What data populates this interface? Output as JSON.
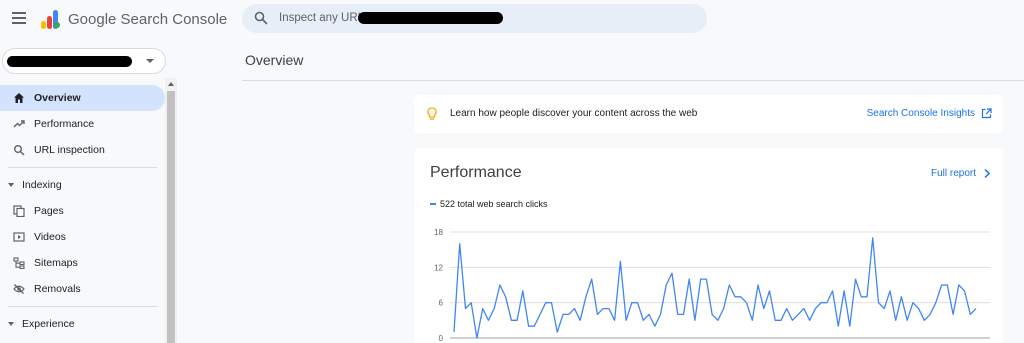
{
  "app": {
    "title": "Google Search Console",
    "brand_colors": [
      "#fbbc04",
      "#ea4335",
      "#4285f4",
      "#34a853"
    ]
  },
  "search": {
    "placeholder": "Inspect any URL i"
  },
  "property": {
    "value_redacted": true
  },
  "nav": {
    "items": [
      {
        "label": "Overview",
        "icon": "home-icon",
        "active": true
      },
      {
        "label": "Performance",
        "icon": "trending-up-icon"
      },
      {
        "label": "URL inspection",
        "icon": "search-icon"
      }
    ],
    "indexing": {
      "label": "Indexing",
      "items": [
        {
          "label": "Pages",
          "icon": "pages-icon"
        },
        {
          "label": "Videos",
          "icon": "video-icon"
        },
        {
          "label": "Sitemaps",
          "icon": "sitemap-icon"
        },
        {
          "label": "Removals",
          "icon": "visibility-off-icon"
        }
      ]
    },
    "experience": {
      "label": "Experience"
    }
  },
  "main": {
    "page_title": "Overview",
    "insights": {
      "text": "Learn how people discover your content across the web",
      "link": "Search Console Insights",
      "icon": "lightbulb-icon"
    },
    "performance": {
      "title": "Performance",
      "full_report": "Full report",
      "legend": "522 total web search clicks",
      "series_color": "#4285f4"
    }
  },
  "chart_data": {
    "type": "line",
    "ylim": [
      0,
      18
    ],
    "yticks": [
      0,
      6,
      12,
      18
    ],
    "series": [
      {
        "values": [
          1,
          16,
          5,
          6,
          0,
          5,
          3,
          5,
          9,
          7,
          3,
          3,
          8,
          2,
          2,
          4,
          6,
          6,
          1,
          4,
          4,
          5,
          3,
          7,
          10,
          4,
          5,
          5,
          3,
          13,
          3,
          6,
          6,
          3,
          4,
          2,
          4,
          9,
          11,
          4,
          4,
          10,
          3,
          10,
          10,
          4,
          3,
          5,
          9,
          7,
          7,
          6,
          3,
          9,
          5,
          8,
          3,
          3,
          5,
          3,
          4,
          5,
          3,
          5,
          6,
          6,
          8,
          2,
          8,
          2,
          10,
          7,
          7,
          17,
          6,
          5,
          8,
          3,
          7,
          3,
          6,
          5,
          3,
          4,
          6,
          9,
          9,
          4,
          9,
          8,
          4,
          5
        ]
      }
    ]
  }
}
